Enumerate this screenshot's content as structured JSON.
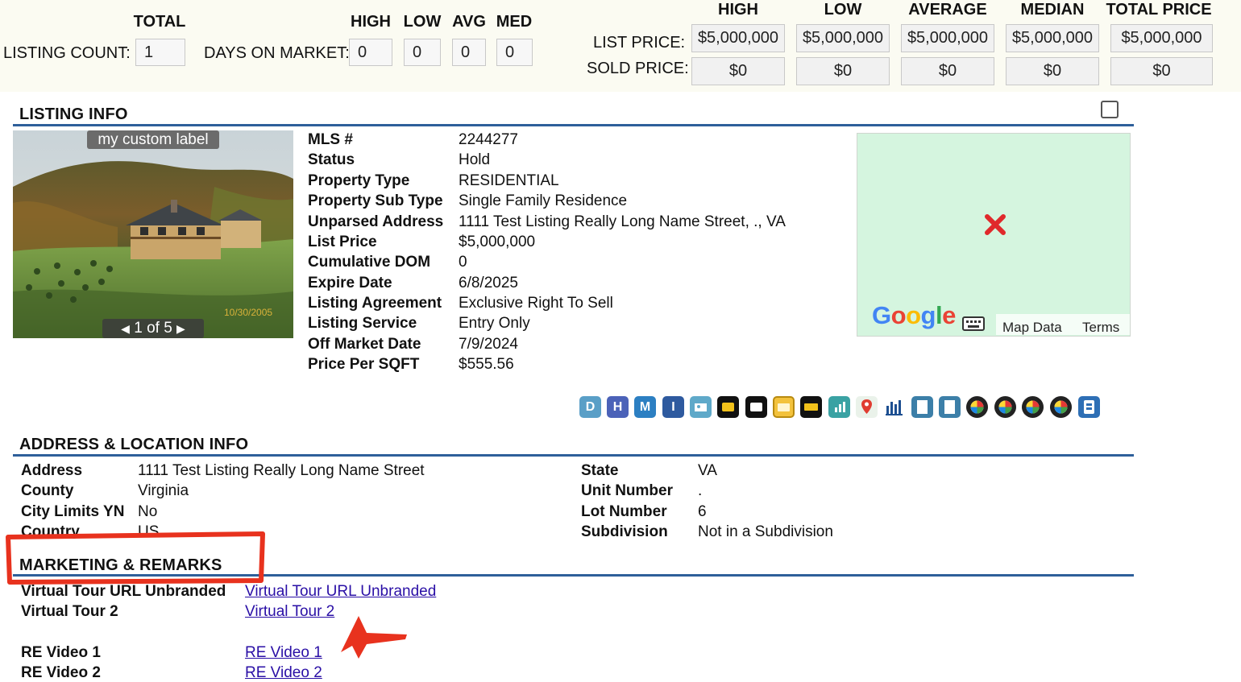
{
  "stats": {
    "total_header": "TOTAL",
    "listing_count_label": "LISTING COUNT:",
    "listing_count_value": "1",
    "dom_label": "DAYS ON MARKET:",
    "dom_headers": [
      "HIGH",
      "LOW",
      "AVG",
      "MED"
    ],
    "dom_values": [
      "0",
      "0",
      "0",
      "0"
    ],
    "price_headers": [
      "HIGH",
      "LOW",
      "AVERAGE",
      "MEDIAN",
      "TOTAL PRICE"
    ],
    "list_price_label": "LIST PRICE:",
    "list_price_values": [
      "$5,000,000",
      "$5,000,000",
      "$5,000,000",
      "$5,000,000",
      "$5,000,000"
    ],
    "sold_price_label": "SOLD PRICE:",
    "sold_price_values": [
      "$0",
      "$0",
      "$0",
      "$0",
      "$0"
    ]
  },
  "listing_info": {
    "title": "LISTING INFO",
    "photo_label": "my custom label",
    "photo_pager": "1 of 5",
    "photo_date_stamp": "10/30/2005",
    "fields": [
      {
        "label": "MLS #",
        "value": "2244277"
      },
      {
        "label": "Status",
        "value": "Hold"
      },
      {
        "label": "Property Type",
        "value": "RESIDENTIAL"
      },
      {
        "label": "Property Sub Type",
        "value": "Single Family Residence"
      },
      {
        "label": "Unparsed Address",
        "value": "1111 Test Listing Really Long Name Street, ., VA"
      },
      {
        "label": "List Price",
        "value": "$5,000,000"
      },
      {
        "label": "Cumulative DOM",
        "value": "0"
      },
      {
        "label": "Expire Date",
        "value": "6/8/2025"
      },
      {
        "label": "Listing Agreement",
        "value": "Exclusive Right To Sell"
      },
      {
        "label": "Listing Service",
        "value": "Entry Only"
      },
      {
        "label": "Off Market Date",
        "value": "7/9/2024"
      },
      {
        "label": "Price Per SQFT",
        "value": "$555.56"
      }
    ],
    "map": {
      "brand": "Google",
      "map_data": "Map Data",
      "terms": "Terms"
    },
    "toolbar": [
      "D",
      "H",
      "M",
      "I"
    ]
  },
  "address": {
    "title": "ADDRESS & LOCATION INFO",
    "left": [
      {
        "label": "Address",
        "value": "1111 Test Listing Really Long Name Street"
      },
      {
        "label": "County",
        "value": "Virginia"
      },
      {
        "label": "City Limits YN",
        "value": "No"
      },
      {
        "label": "Country",
        "value": "US"
      }
    ],
    "right": [
      {
        "label": "State",
        "value": "VA"
      },
      {
        "label": "Unit Number",
        "value": "."
      },
      {
        "label": "Lot Number",
        "value": "6"
      },
      {
        "label": "Subdivision",
        "value": "Not in a Subdivision"
      }
    ]
  },
  "marketing": {
    "title": "MARKETING & REMARKS",
    "rows": [
      {
        "label": "Virtual Tour URL Unbranded",
        "value": "Virtual Tour URL Unbranded"
      },
      {
        "label": "Virtual Tour 2",
        "value": "Virtual Tour 2"
      },
      {
        "label": "RE Video 1",
        "value": "RE Video 1"
      },
      {
        "label": "RE Video 2",
        "value": "RE Video 2"
      }
    ]
  },
  "colors": {
    "section_rule": "#2e5f9a",
    "link": "#2a0fa6",
    "annotation": "#e8321e",
    "map_bg": "#d5f5df"
  }
}
